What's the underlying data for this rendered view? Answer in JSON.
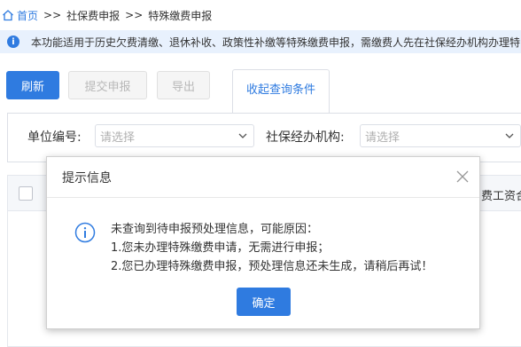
{
  "breadcrumb": {
    "home": "首页",
    "separator": ">>",
    "level2": "社保费申报",
    "level3": "特殊缴费申报"
  },
  "notice": {
    "icon": "info-icon",
    "text": "本功能适用于历史欠费清缴、退休补收、政策性补缴等特殊缴费申报，需缴费人先在社保经办机构办理特"
  },
  "toolbar": {
    "refresh": "刷新",
    "submit": "提交申报",
    "export": "导出",
    "query_tab": "收起查询条件"
  },
  "filters": {
    "unit_code_label": "单位编号:",
    "unit_code_placeholder": "请选择",
    "agency_label": "社保经办机构:",
    "agency_placeholder": "请选择"
  },
  "table": {
    "partial_header": "费工资合"
  },
  "dialog": {
    "title": "提示信息",
    "lines": [
      "未查询到待申报预处理信息，可能原因：",
      "1.您未办理特殊缴费申请，无需进行申报；",
      "2.您已办理特殊缴费申报，预处理信息还未生成，请稍后再试！"
    ],
    "ok": "确定"
  },
  "colors": {
    "primary": "#2f7be0",
    "notice_bg": "#e8f1fd"
  }
}
